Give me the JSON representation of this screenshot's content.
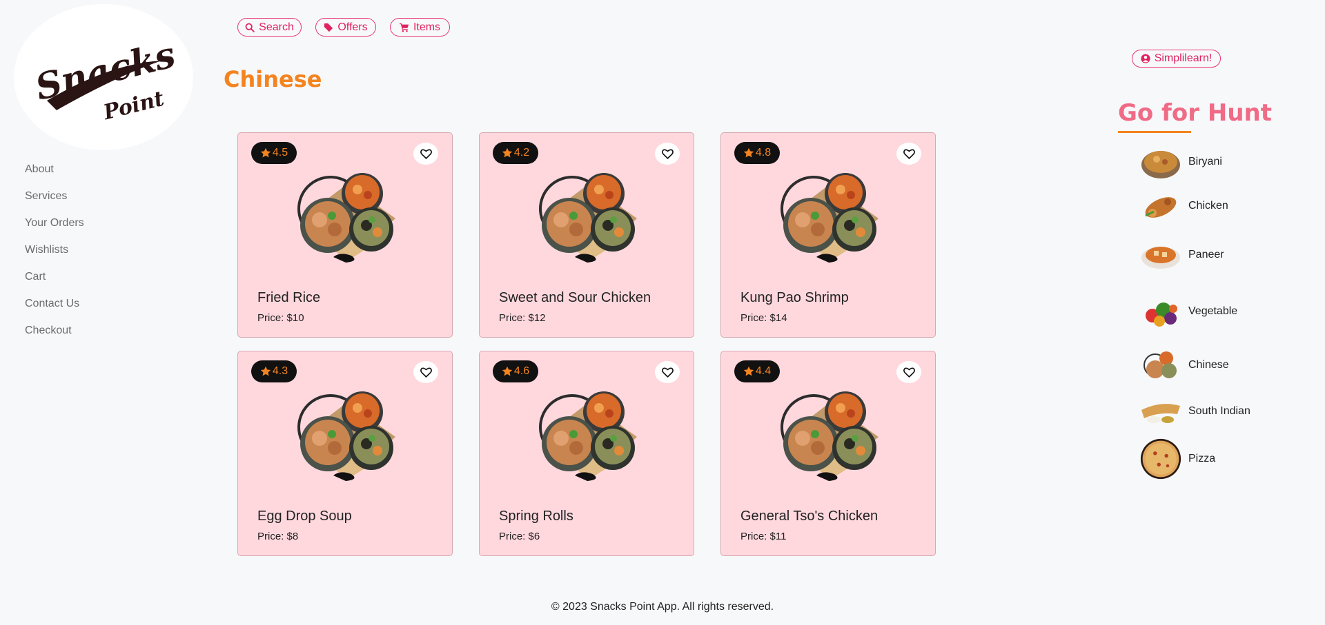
{
  "brand": {
    "line1": "Snacks",
    "line2": "Point"
  },
  "nav": {
    "items": [
      "About",
      "Services",
      "Your Orders",
      "Wishlists",
      "Cart",
      "Contact Us",
      "Checkout"
    ]
  },
  "toolbar": {
    "search": "Search",
    "offers": "Offers",
    "items": "Items"
  },
  "user": {
    "label": "Simplilearn!"
  },
  "page": {
    "title": "Chinese"
  },
  "price_prefix": "Price: ",
  "products": [
    {
      "name": "Fried Rice",
      "rating": "4.5",
      "price": "$10"
    },
    {
      "name": "Sweet and Sour Chicken",
      "rating": "4.2",
      "price": "$12"
    },
    {
      "name": "Kung Pao Shrimp",
      "rating": "4.8",
      "price": "$14"
    },
    {
      "name": "Egg Drop Soup",
      "rating": "4.3",
      "price": "$8"
    },
    {
      "name": "Spring Rolls",
      "rating": "4.6",
      "price": "$6"
    },
    {
      "name": "General Tso's Chicken",
      "rating": "4.4",
      "price": "$11"
    }
  ],
  "hunt": {
    "title": "Go for Hunt",
    "categories": [
      "Biryani",
      "Chicken",
      "Paneer",
      "Vegetable",
      "Chinese",
      "South Indian",
      "Pizza"
    ]
  },
  "footer": {
    "text": "© 2023 Snacks Point App. All rights reserved."
  },
  "colors": {
    "accent": "#e0235f",
    "orange": "#f48420",
    "card_bg": "#ffd8de",
    "hunt": "#f06b86"
  }
}
